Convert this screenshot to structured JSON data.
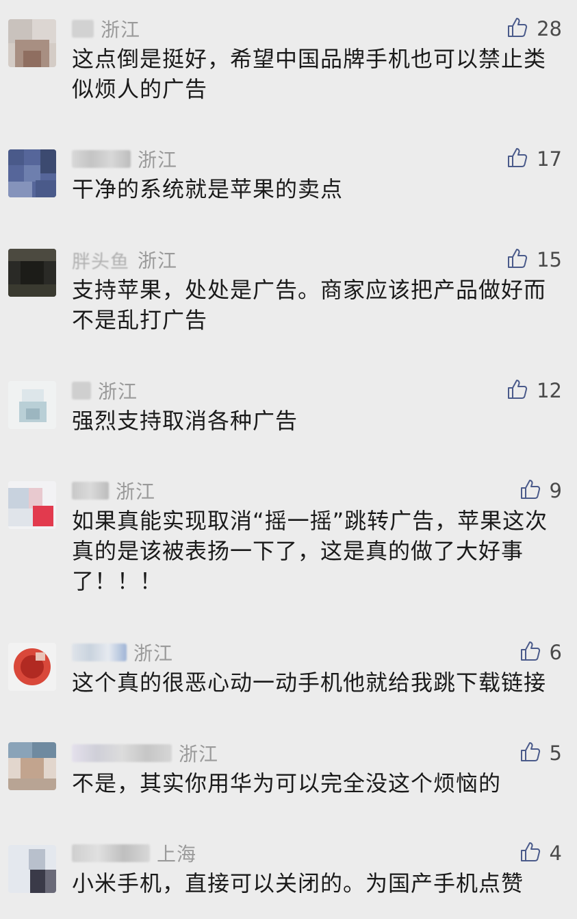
{
  "comments": [
    {
      "location": "浙江",
      "likes": "28",
      "text": "这点倒是挺好，希望中国品牌手机也可以禁止类似烦人的广告",
      "avatar_colors": [
        "#c9c2bd",
        "#a88f82",
        "#dcd6d2",
        "#8f6e60"
      ]
    },
    {
      "location": "浙江",
      "likes": "17",
      "text": "干净的系统就是苹果的卖点",
      "avatar_colors": [
        "#4a5a8a",
        "#6e7fae",
        "#3c4a70",
        "#8593bb"
      ]
    },
    {
      "name_partial": "胖头鱼",
      "location": "浙江",
      "likes": "15",
      "text": "支持苹果，处处是广告。商家应该把产品做好而不是乱打广告",
      "avatar_colors": [
        "#2a2a26",
        "#4c4a40",
        "#1c1c18",
        "#3a3a30"
      ]
    },
    {
      "location": "浙江",
      "likes": "12",
      "text": "强烈支持取消各种广告",
      "avatar_colors": [
        "#f0f2f2",
        "#b9cfd6",
        "#dde6ea",
        "#9cb6c0"
      ]
    },
    {
      "location": "浙江",
      "likes": "9",
      "text": "如果真能实现取消“摇一摇”跳转广告，苹果这次真的是该被表扬一下了，这是真的做了大好事了！！！",
      "avatar_colors": [
        "#c8d2de",
        "#e8c9cf",
        "#e23a4e",
        "#ffffff"
      ]
    },
    {
      "location": "浙江",
      "likes": "6",
      "text": "这个真的很恶心动一动手机他就给我跳下载链接",
      "avatar_colors": [
        "#b12a22",
        "#d9483a",
        "#e9c4b8",
        "#f2f2f2"
      ]
    },
    {
      "location": "浙江",
      "likes": "5",
      "text": "不是，其实你用华为可以完全没这个烦恼的",
      "avatar_colors": [
        "#8aa3b8",
        "#c2a48e",
        "#e2d6cd",
        "#6f8aa0"
      ]
    },
    {
      "location": "上海",
      "likes": "4",
      "text": "小米手机，直接可以关闭的。为国产手机点赞",
      "avatar_colors": [
        "#e4e8ee",
        "#3a3a48",
        "#b8c0cc",
        "#6a6a78"
      ]
    }
  ]
}
